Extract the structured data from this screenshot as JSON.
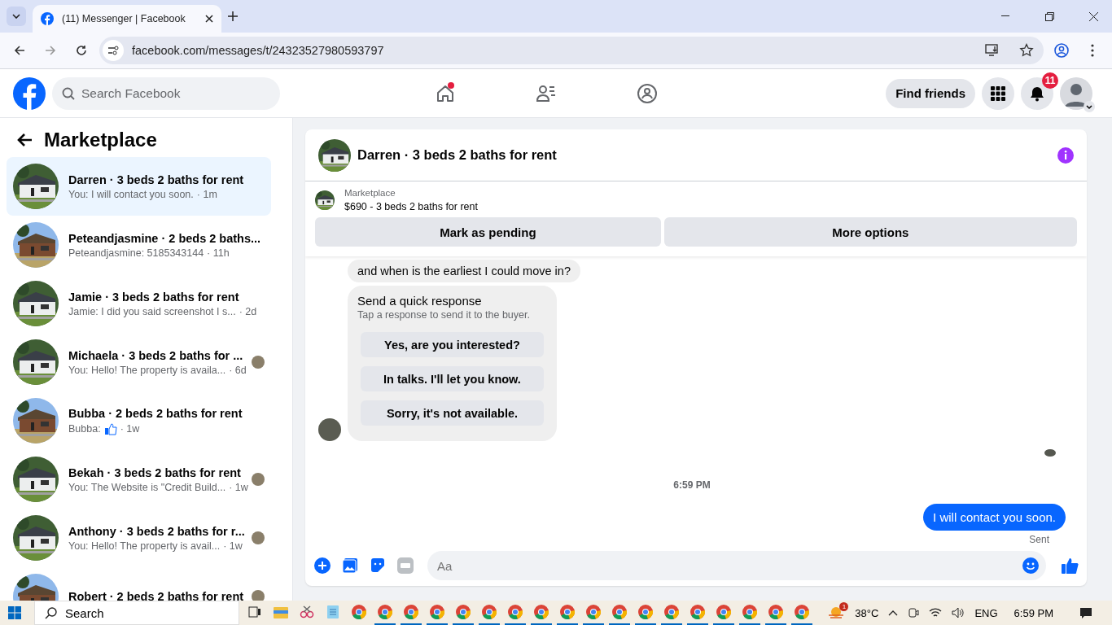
{
  "browser": {
    "tab_title": "(11) Messenger | Facebook",
    "url": "facebook.com/messages/t/24323527980593797"
  },
  "header": {
    "search_placeholder": "Search Facebook",
    "home_has_dot": true,
    "find_friends": "Find friends",
    "notification_count": "11"
  },
  "sidebar": {
    "title": "Marketplace",
    "items": [
      {
        "title": "Darren · 3 beds 2 baths for rent",
        "preview": "You: I will contact you soon.",
        "time": "· 1m",
        "selected": true,
        "seen_avatar": false
      },
      {
        "title": "Peteandjasmine · 2 beds 2 baths...",
        "preview": "Peteandjasmine: 5185343144",
        "time": "· 11h",
        "selected": false,
        "seen_avatar": false
      },
      {
        "title": "Jamie · 3 beds 2 baths for rent",
        "preview": "Jamie: I did you said screenshot I s...",
        "time": "· 2d",
        "selected": false,
        "seen_avatar": false
      },
      {
        "title": "Michaela · 3 beds 2 baths for ...",
        "preview": "You: Hello! The property is availa...",
        "time": "· 6d",
        "selected": false,
        "seen_avatar": true
      },
      {
        "title": "Bubba · 2 beds 2 baths for rent",
        "preview": "Bubba:",
        "time": "· 1w",
        "selected": false,
        "seen_avatar": false,
        "like": true
      },
      {
        "title": "Bekah · 3 beds 2 baths for rent",
        "preview": "You: The Website is \"Credit Build...",
        "time": "· 1w",
        "selected": false,
        "seen_avatar": true
      },
      {
        "title": "Anthony · 3 beds 2 baths for r...",
        "preview": "You: Hello! The property is avail...",
        "time": "· 1w",
        "selected": false,
        "seen_avatar": true
      },
      {
        "title": "Robert · 2 beds 2 baths for rent",
        "selected": false,
        "seen_avatar": true
      }
    ]
  },
  "chat": {
    "title": "Darren · 3 beds 2 baths for rent",
    "listing_label": "Marketplace",
    "listing": "$690 - 3 beds 2 baths for rent",
    "actions": [
      "Mark as pending",
      "More options"
    ],
    "partial_message": "and when is the earliest I could move in?",
    "quick_title": "Send a quick response",
    "quick_hint": "Tap a response to send it to the buyer.",
    "quick_replies": [
      "Yes, are you interested?",
      "In talks. I'll let you know.",
      "Sorry, it's not available."
    ],
    "timestamp": "6:59 PM",
    "sent_message": "I will contact you soon.",
    "status": "Sent",
    "composer_placeholder": "Aa"
  },
  "taskbar": {
    "search": "Search",
    "apps": [
      {
        "kind": "taskview"
      },
      {
        "kind": "folder"
      },
      {
        "kind": "snip"
      },
      {
        "kind": "notepad"
      },
      {
        "kind": "chrome",
        "running": false
      },
      {
        "kind": "chrome",
        "running": true
      },
      {
        "kind": "chrome",
        "running": true
      },
      {
        "kind": "chrome",
        "running": true
      },
      {
        "kind": "chrome",
        "running": true
      },
      {
        "kind": "chrome",
        "running": true
      },
      {
        "kind": "chrome",
        "running": true
      },
      {
        "kind": "chrome",
        "running": true
      },
      {
        "kind": "chrome",
        "running": true
      },
      {
        "kind": "chrome",
        "running": true
      },
      {
        "kind": "chrome",
        "running": true
      },
      {
        "kind": "chrome",
        "running": true
      },
      {
        "kind": "chrome",
        "running": true
      },
      {
        "kind": "chrome",
        "running": true
      },
      {
        "kind": "chrome",
        "running": true
      },
      {
        "kind": "chrome",
        "running": true
      },
      {
        "kind": "chrome",
        "running": true
      },
      {
        "kind": "chrome",
        "running": true
      }
    ],
    "weather_badge": "1",
    "temperature": "38°C",
    "language": "ENG",
    "time": "6:59 PM"
  }
}
